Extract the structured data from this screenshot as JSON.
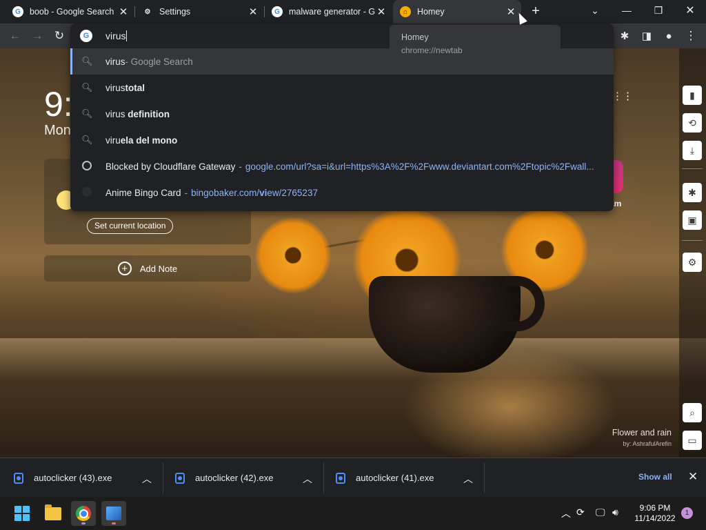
{
  "tabs": [
    {
      "title": "boob - Google Search",
      "favicon": "google-icon",
      "active": false
    },
    {
      "title": "Settings",
      "favicon": "gear-icon",
      "active": false
    },
    {
      "title": "malware generator - G",
      "favicon": "google-icon",
      "active": false
    },
    {
      "title": "Homey",
      "favicon": "home-icon",
      "active": true
    }
  ],
  "hover_card": {
    "title": "Homey",
    "url": "chrome://newtab"
  },
  "omnibox": {
    "query": "virus",
    "suggestions": [
      {
        "typed": "virus",
        "rest": "",
        "suffix": " - Google Search",
        "icon": "search-icon"
      },
      {
        "typed": "virus",
        "rest": "total",
        "icon": "search-icon"
      },
      {
        "typed": "virus",
        "rest": " definition",
        "icon": "search-icon"
      },
      {
        "typed": "viru",
        "rest": "ela del mono",
        "icon": "search-icon"
      },
      {
        "title": "Blocked by Cloudflare Gateway",
        "url": "google.com/url?sa=i&url=https%3A%2F%2Fwww.deviantart.com%2Ftopic%2Fwall...",
        "icon": "globe-icon"
      },
      {
        "title": "Anime Bingo Card",
        "url_pre": "bingobaker.com/",
        "url_bold": "vi",
        "url_post": "ew/2765237",
        "icon": "site-icon"
      }
    ]
  },
  "newtab": {
    "clock": "9:",
    "date": "Mon",
    "set_location": "Set current location",
    "add_note": "Add Note",
    "shortcut_label": "am",
    "photo_title": "Flower and rain",
    "photo_credit": "by: AshrafulArefin"
  },
  "downloads": {
    "items": [
      "autoclicker (43).exe",
      "autoclicker (42).exe",
      "autoclicker (41).exe"
    ],
    "show_all": "Show all"
  },
  "taskbar": {
    "time": "9:06 PM",
    "date": "11/14/2022",
    "notifications": "1"
  },
  "colors": {
    "accent": "#8ab4f8",
    "omnibox_bg": "#202124",
    "toolbar_bg": "#35363a"
  }
}
